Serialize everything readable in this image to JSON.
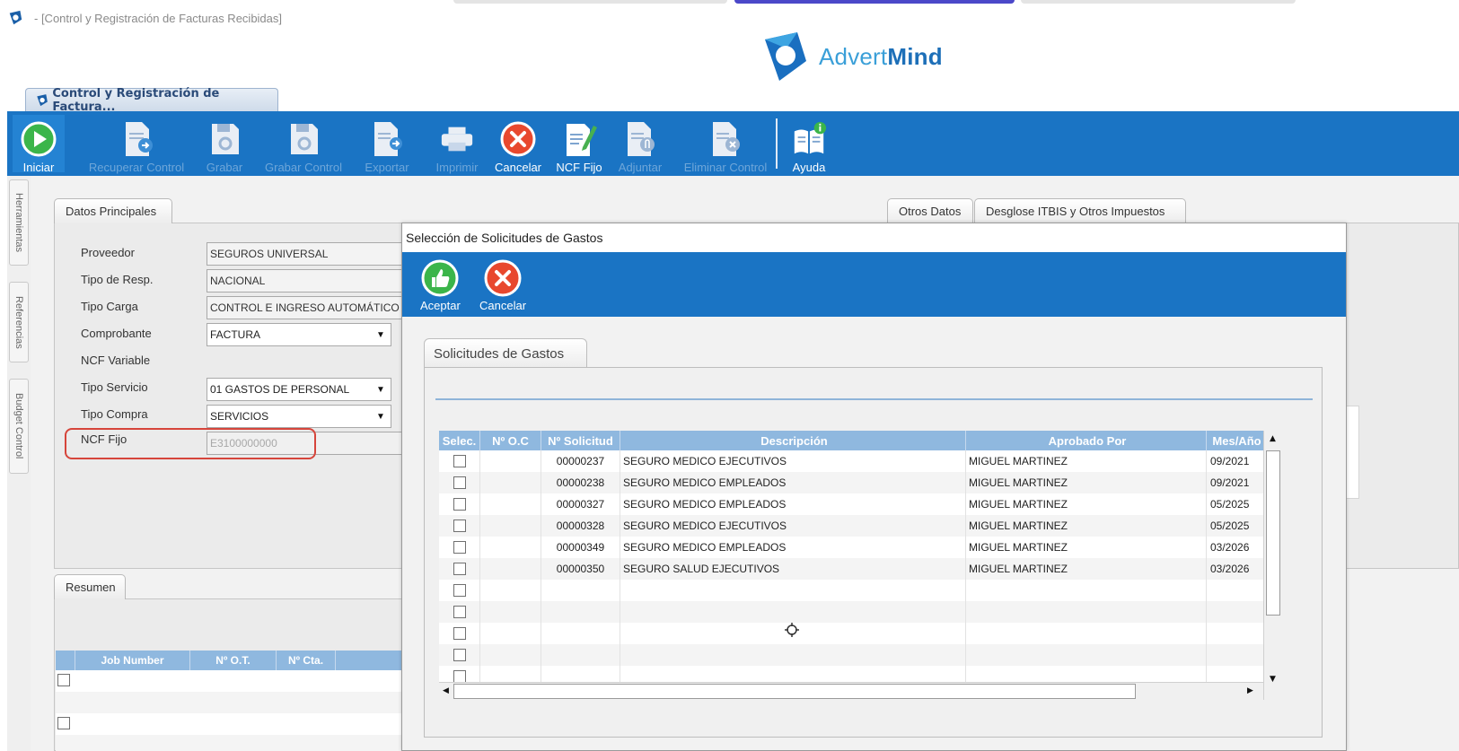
{
  "window": {
    "title": "- [Control y Registración de Facturas Recibidas]",
    "tab_label": "Control y Registración de Factura..."
  },
  "brand": {
    "name_light": "Advert",
    "name_bold": "Mind"
  },
  "colors": {
    "toolbar_blue": "#1a74c4",
    "grid_header": "#8fb8df",
    "highlight": "#d6453b"
  },
  "toolbar": {
    "buttons": [
      {
        "label": "Iniciar",
        "icon": "play-icon",
        "enabled": true
      },
      {
        "label": "Recuperar Control",
        "icon": "document-recover-icon",
        "enabled": false
      },
      {
        "label": "Grabar",
        "icon": "save-icon",
        "enabled": false
      },
      {
        "label": "Grabar Control",
        "icon": "save-control-icon",
        "enabled": false
      },
      {
        "label": "Exportar",
        "icon": "export-icon",
        "enabled": false
      },
      {
        "label": "Imprimir",
        "icon": "printer-icon",
        "enabled": false
      },
      {
        "label": "Cancelar",
        "icon": "cancel-icon",
        "enabled": true
      },
      {
        "label": "NCF Fijo",
        "icon": "edit-document-icon",
        "enabled": true
      },
      {
        "label": "Adjuntar",
        "icon": "attach-icon",
        "enabled": false
      },
      {
        "label": "Eliminar Control",
        "icon": "delete-document-icon",
        "enabled": false
      },
      {
        "label": "Ayuda",
        "icon": "help-book-icon",
        "enabled": true
      }
    ]
  },
  "side_tabs": [
    "Herramientas",
    "Referencias",
    "Budget Control"
  ],
  "tabs": {
    "datos_principales": "Datos Principales",
    "otros_datos": "Otros Datos",
    "desglose": "Desglose ITBIS y Otros Impuestos",
    "resumen": "Resumen"
  },
  "form": {
    "proveedor": {
      "label": "Proveedor",
      "value": "SEGUROS UNIVERSAL"
    },
    "tipo_resp": {
      "label": "Tipo de Resp.",
      "value": "NACIONAL"
    },
    "tipo_carga": {
      "label": "Tipo Carga",
      "value": "CONTROL E INGRESO AUTOMÁTICO"
    },
    "comprobante": {
      "label": "Comprobante",
      "value": "FACTURA"
    },
    "ncf_variable": {
      "label": "NCF Variable"
    },
    "tipo_servicio": {
      "label": "Tipo Servicio",
      "value": "01 GASTOS DE PERSONAL"
    },
    "tipo_compra": {
      "label": "Tipo Compra",
      "value": "SERVICIOS"
    },
    "ncf_fijo": {
      "label": "NCF Fijo",
      "value": "E3100000000"
    }
  },
  "resumen_table": {
    "columns": [
      "Job Number",
      "Nº O.T.",
      "Nº Cta."
    ],
    "empty_rows": 4
  },
  "dialog": {
    "title": "Selección de Solicitudes de Gastos",
    "accept_label": "Aceptar",
    "cancel_label": "Cancelar",
    "tab_label": "Solicitudes de Gastos",
    "columns": [
      "Selec.",
      "Nº O.C",
      "Nº Solicitud",
      "Descripción",
      "Aprobado Por",
      "Mes/Año"
    ],
    "rows": [
      {
        "oc": "",
        "solicitud": "00000237",
        "descripcion": "SEGURO MEDICO EJECUTIVOS",
        "aprobado": "MIGUEL MARTINEZ",
        "mes": "09/2021"
      },
      {
        "oc": "",
        "solicitud": "00000238",
        "descripcion": "SEGURO MEDICO EMPLEADOS",
        "aprobado": "MIGUEL MARTINEZ",
        "mes": "09/2021"
      },
      {
        "oc": "",
        "solicitud": "00000327",
        "descripcion": "SEGURO MEDICO EMPLEADOS",
        "aprobado": "MIGUEL MARTINEZ",
        "mes": "05/2025"
      },
      {
        "oc": "",
        "solicitud": "00000328",
        "descripcion": "SEGURO MEDICO EJECUTIVOS",
        "aprobado": "MIGUEL MARTINEZ",
        "mes": "05/2025"
      },
      {
        "oc": "",
        "solicitud": "00000349",
        "descripcion": "SEGURO MEDICO EMPLEADOS",
        "aprobado": "MIGUEL MARTINEZ",
        "mes": "03/2026"
      },
      {
        "oc": "",
        "solicitud": "00000350",
        "descripcion": "SEGURO SALUD EJECUTIVOS",
        "aprobado": "MIGUEL MARTINEZ",
        "mes": "03/2026"
      }
    ],
    "empty_rows": 6
  }
}
